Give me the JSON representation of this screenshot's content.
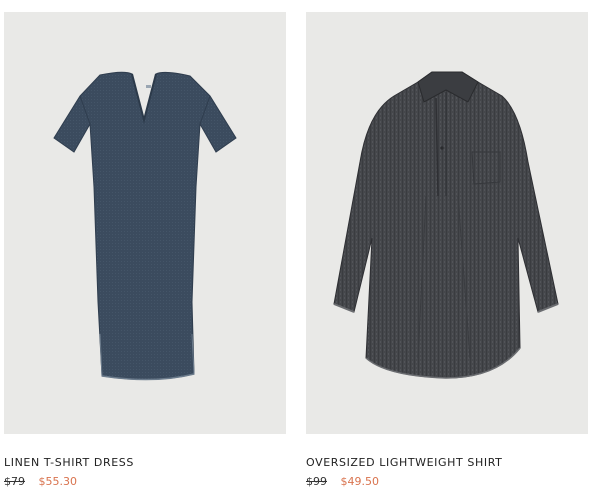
{
  "products": [
    {
      "title": "LINEN T-SHIRT DRESS",
      "original_price": "$79",
      "sale_price": "$55.30",
      "image_icon": "linen-tshirt-dress-image",
      "garment_color": "#3a4a5c"
    },
    {
      "title": "OVERSIZED LIGHTWEIGHT SHIRT",
      "original_price": "$99",
      "sale_price": "$49.50",
      "image_icon": "oversized-shirt-image",
      "garment_color": "#46474a"
    }
  ],
  "colors": {
    "image_background": "#e9e9e7",
    "sale_price": "#d9734e",
    "text": "#222222"
  }
}
